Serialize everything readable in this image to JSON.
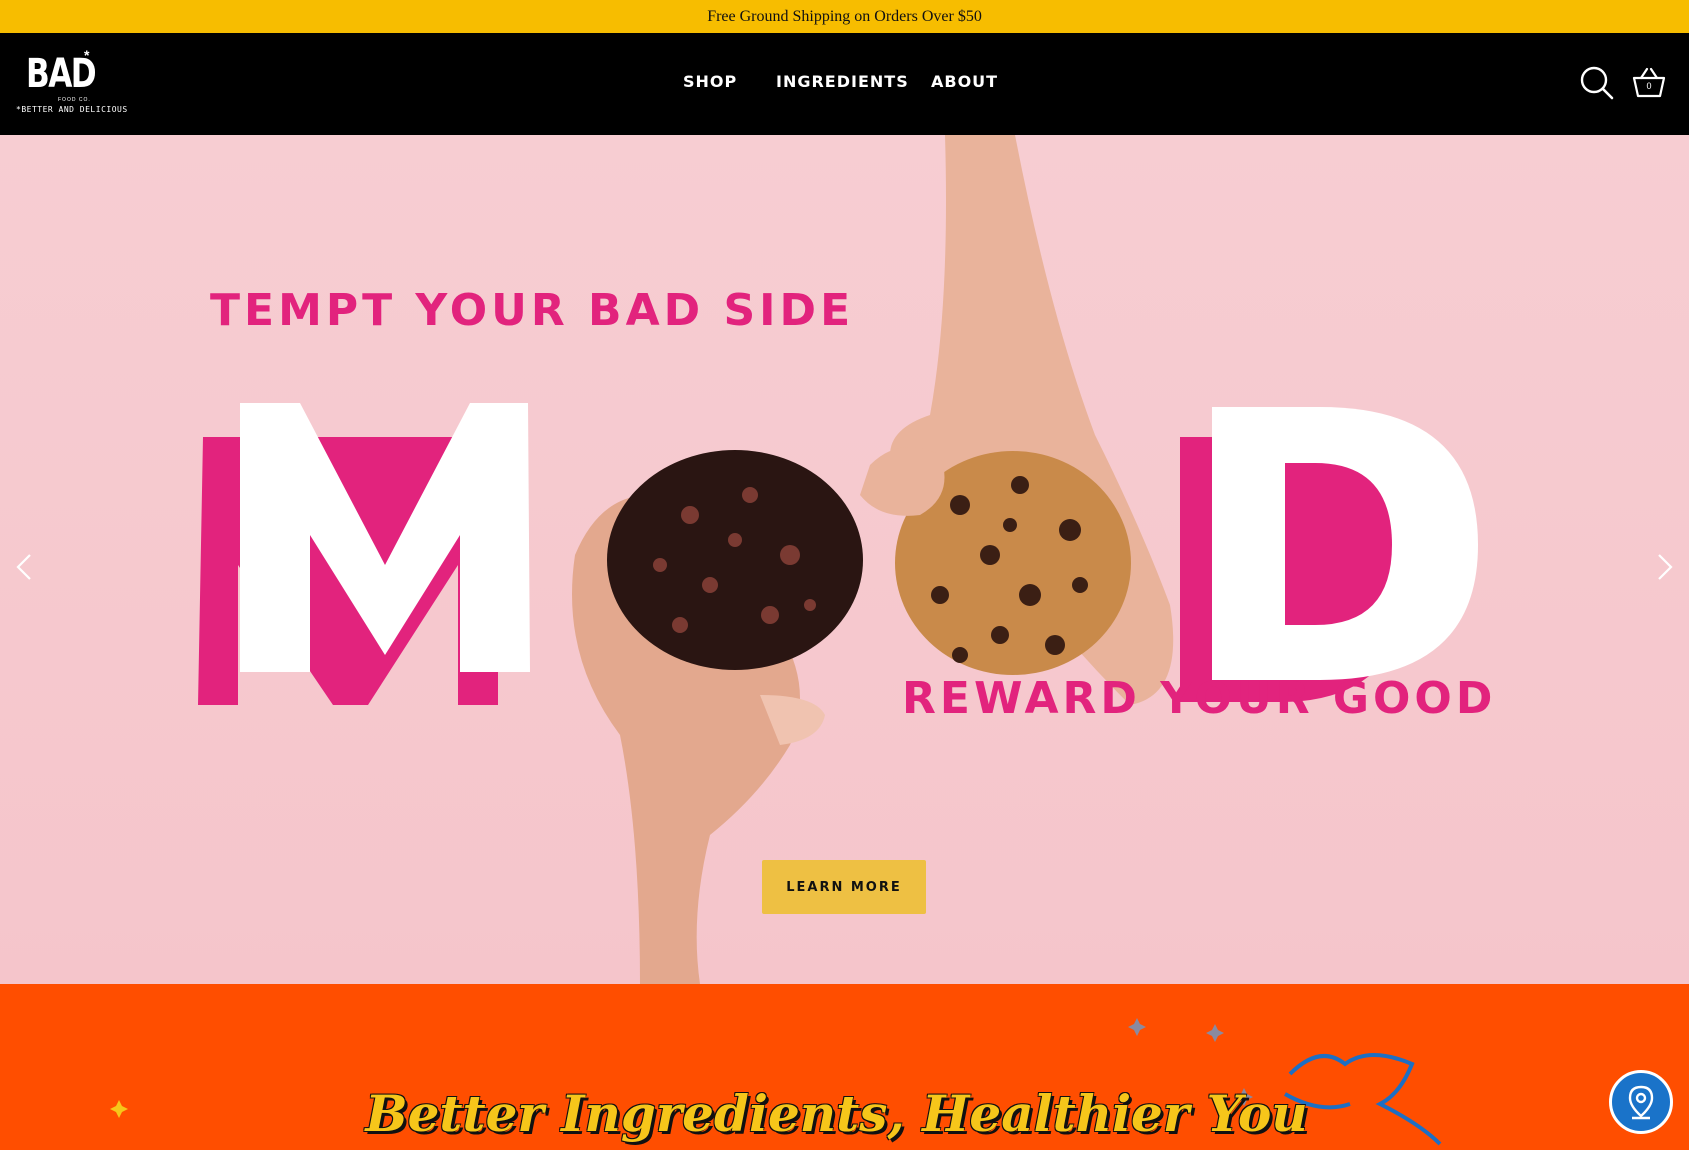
{
  "announcement": {
    "text": "Free Ground Shipping on Orders Over $50"
  },
  "logo": {
    "wordmark": "BAD",
    "star": "*",
    "sub": "FOOD CO.",
    "tagline": "*BETTER AND DELICIOUS"
  },
  "nav": {
    "items": [
      {
        "label": "SHOP"
      },
      {
        "label": "INGREDIENTS"
      },
      {
        "label": "ABOUT"
      }
    ]
  },
  "header": {
    "search_icon": "search-icon",
    "cart_icon": "basket-icon",
    "cart_count": "0"
  },
  "hero": {
    "headline_top": "TEMPT YOUR BAD SIDE",
    "letter_m": "M",
    "letter_d": "D",
    "headline_bottom": "REWARD YOUR GOOD",
    "cta_label": "LEARN MORE",
    "prev_icon": "chevron-left-icon",
    "next_icon": "chevron-right-icon",
    "colors": {
      "background": "#f7cdd2",
      "accent_pink": "#e2237d",
      "button": "#eec043"
    }
  },
  "section": {
    "title": "Better Ingredients, Healthier You",
    "background": "#ff4e00",
    "title_color": "#f6c61a"
  },
  "store_locator": {
    "icon": "map-pin-icon"
  },
  "colors": {
    "announcement_bg": "#f7bd00",
    "header_bg": "#000000"
  }
}
